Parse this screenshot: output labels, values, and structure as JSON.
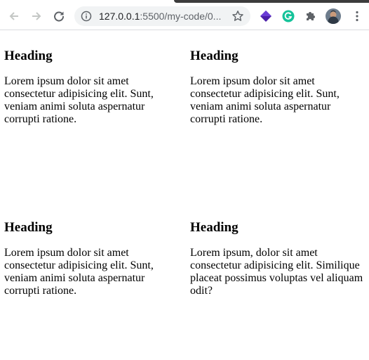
{
  "browser": {
    "url_host": "127.0.0.1",
    "url_rest": ":5500/my-code/0..."
  },
  "cards": [
    {
      "heading": "Heading",
      "text": "Lorem ipsum dolor sit amet consectetur adipisicing elit. Sunt, veniam animi soluta aspernatur corrupti ratione."
    },
    {
      "heading": "Heading",
      "text": "Lorem ipsum dolor sit amet consectetur adipisicing elit. Sunt, veniam animi soluta aspernatur corrupti ratione."
    },
    {
      "heading": "Heading",
      "text": "Lorem ipsum dolor sit amet consectetur adipisicing elit. Sunt, veniam animi soluta aspernatur corrupti ratione."
    },
    {
      "heading": "Heading",
      "text": "Lorem ipsum, dolor sit amet consectetur adipisicing elit. Similique placeat possimus voluptas vel aliquam odit?"
    }
  ],
  "icons": {
    "back": "arrow-back-icon",
    "forward": "arrow-forward-icon",
    "reload": "reload-icon",
    "info": "info-icon",
    "bookmark": "star-icon",
    "ext1": "purple-cube-extension-icon",
    "ext2": "grammarly-extension-icon",
    "extensions": "puzzle-icon",
    "profile": "profile-avatar",
    "menu": "kebab-menu-icon"
  },
  "colors": {
    "grammarly": "#15c39a",
    "ext_purple": "#4b1fa8"
  }
}
